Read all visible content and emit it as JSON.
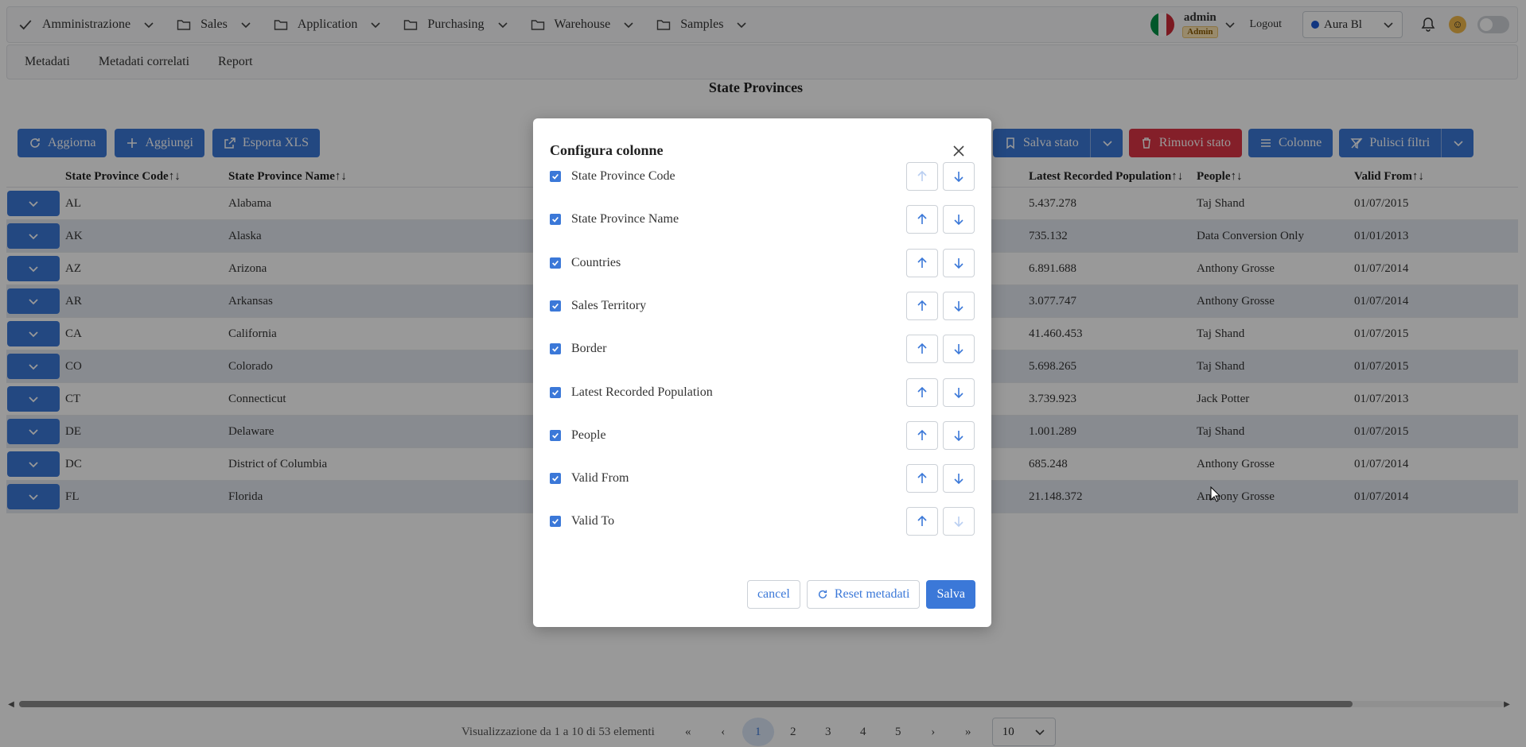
{
  "nav": {
    "items": [
      {
        "label": "Amministrazione",
        "icon": "check-icon"
      },
      {
        "label": "Sales",
        "icon": "folder-icon"
      },
      {
        "label": "Application",
        "icon": "folder-icon"
      },
      {
        "label": "Purchasing",
        "icon": "folder-icon"
      },
      {
        "label": "Warehouse",
        "icon": "folder-icon"
      },
      {
        "label": "Samples",
        "icon": "folder-icon"
      }
    ],
    "user_name": "admin",
    "user_role": "Admin",
    "logout_label": "Logout",
    "theme_value": "Aura Bl"
  },
  "subnav": {
    "items": [
      "Metadati",
      "Metadati correlati",
      "Report"
    ]
  },
  "page": {
    "title": "State Provinces"
  },
  "toolbar": {
    "refresh_label": "Aggiorna",
    "add_label": "Aggiungi",
    "export_label": "Esporta XLS",
    "save_state_label": "Salva stato",
    "remove_state_label": "Rimuovi stato",
    "columns_label": "Colonne",
    "clear_filters_label": "Pulisci filtri"
  },
  "table": {
    "headers": {
      "code": "State Province Code↑↓",
      "name": "State Province Name↑↓",
      "population": "Latest Recorded Population↑↓",
      "people": "People↑↓",
      "valid_from": "Valid From↑↓"
    },
    "rows": [
      {
        "code": "AL",
        "name": "Alabama",
        "population": "5.437.278",
        "people": "Taj Shand",
        "valid_from": "01/07/2015"
      },
      {
        "code": "AK",
        "name": "Alaska",
        "population": "735.132",
        "people": "Data Conversion Only",
        "valid_from": "01/01/2013"
      },
      {
        "code": "AZ",
        "name": "Arizona",
        "population": "6.891.688",
        "people": "Anthony Grosse",
        "valid_from": "01/07/2014"
      },
      {
        "code": "AR",
        "name": "Arkansas",
        "population": "3.077.747",
        "people": "Anthony Grosse",
        "valid_from": "01/07/2014"
      },
      {
        "code": "CA",
        "name": "California",
        "population": "41.460.453",
        "people": "Taj Shand",
        "valid_from": "01/07/2015"
      },
      {
        "code": "CO",
        "name": "Colorado",
        "population": "5.698.265",
        "people": "Taj Shand",
        "valid_from": "01/07/2015"
      },
      {
        "code": "CT",
        "name": "Connecticut",
        "population": "3.739.923",
        "people": "Jack Potter",
        "valid_from": "01/07/2013"
      },
      {
        "code": "DE",
        "name": "Delaware",
        "population": "1.001.289",
        "people": "Taj Shand",
        "valid_from": "01/07/2015"
      },
      {
        "code": "DC",
        "name": "District of Columbia",
        "population": "685.248",
        "people": "Anthony Grosse",
        "valid_from": "01/07/2014"
      },
      {
        "code": "FL",
        "name": "Florida",
        "population": "21.148.372",
        "people": "Anthony Grosse",
        "valid_from": "01/07/2014"
      }
    ]
  },
  "modal": {
    "title": "Configura colonne",
    "columns": [
      {
        "label": "State Province Code",
        "checked": true,
        "up_disabled": true,
        "down_disabled": false
      },
      {
        "label": "State Province Name",
        "checked": true,
        "up_disabled": false,
        "down_disabled": false
      },
      {
        "label": "Countries",
        "checked": true,
        "up_disabled": false,
        "down_disabled": false
      },
      {
        "label": "Sales Territory",
        "checked": true,
        "up_disabled": false,
        "down_disabled": false
      },
      {
        "label": "Border",
        "checked": true,
        "up_disabled": false,
        "down_disabled": false
      },
      {
        "label": "Latest Recorded Population",
        "checked": true,
        "up_disabled": false,
        "down_disabled": false
      },
      {
        "label": "People",
        "checked": true,
        "up_disabled": false,
        "down_disabled": false
      },
      {
        "label": "Valid From",
        "checked": true,
        "up_disabled": false,
        "down_disabled": false
      },
      {
        "label": "Valid To",
        "checked": true,
        "up_disabled": false,
        "down_disabled": true
      }
    ],
    "cancel_label": "cancel",
    "reset_label": "Reset metadati",
    "save_label": "Salva"
  },
  "pagination": {
    "info": "Visualizzazione da 1 a 10 di 53 elementi",
    "pages": [
      "1",
      "2",
      "3",
      "4",
      "5"
    ],
    "current_page": "1",
    "per_page": "10"
  },
  "colors": {
    "primary": "#3b78d8",
    "danger": "#dc3545",
    "row_alt": "#e3e8f1"
  }
}
